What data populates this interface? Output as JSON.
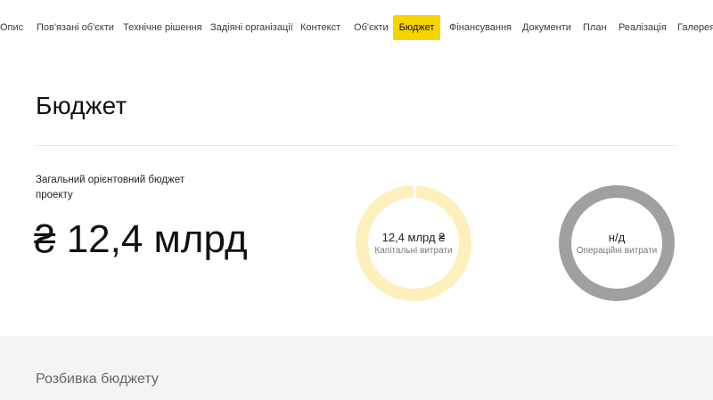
{
  "nav": {
    "items": [
      {
        "label": "Опис",
        "active": false
      },
      {
        "label": "Пов'язані об'єкти",
        "active": false
      },
      {
        "label": "Технічне рішення",
        "active": false
      },
      {
        "label": "Задіяні організації",
        "active": false
      },
      {
        "label": "Контекст",
        "active": false
      },
      {
        "label": "Об'єкти",
        "active": false
      },
      {
        "label": "Бюджет",
        "active": true
      },
      {
        "label": "Фінансування",
        "active": false
      },
      {
        "label": "Документи",
        "active": false
      },
      {
        "label": "План",
        "active": false
      },
      {
        "label": "Реалізація",
        "active": false
      },
      {
        "label": "Галерея",
        "active": false
      }
    ],
    "active_color": "#f5d400"
  },
  "budget": {
    "title": "Бюджет",
    "total_label": "Загальний орієнтовний бюджет проекту",
    "total_value": "₴ 12,4 млрд",
    "capex": {
      "value": "12,4 млрд ₴",
      "caption": "Капітальні витрати",
      "ring_color": "#fdf0bd",
      "fill_fraction": 0.99
    },
    "opex": {
      "value": "н/д",
      "caption": "Операційні витрати",
      "ring_color": "#a0a0a0",
      "fill_fraction": 1
    }
  },
  "breakdown": {
    "title": "Розбивка бюджету"
  }
}
